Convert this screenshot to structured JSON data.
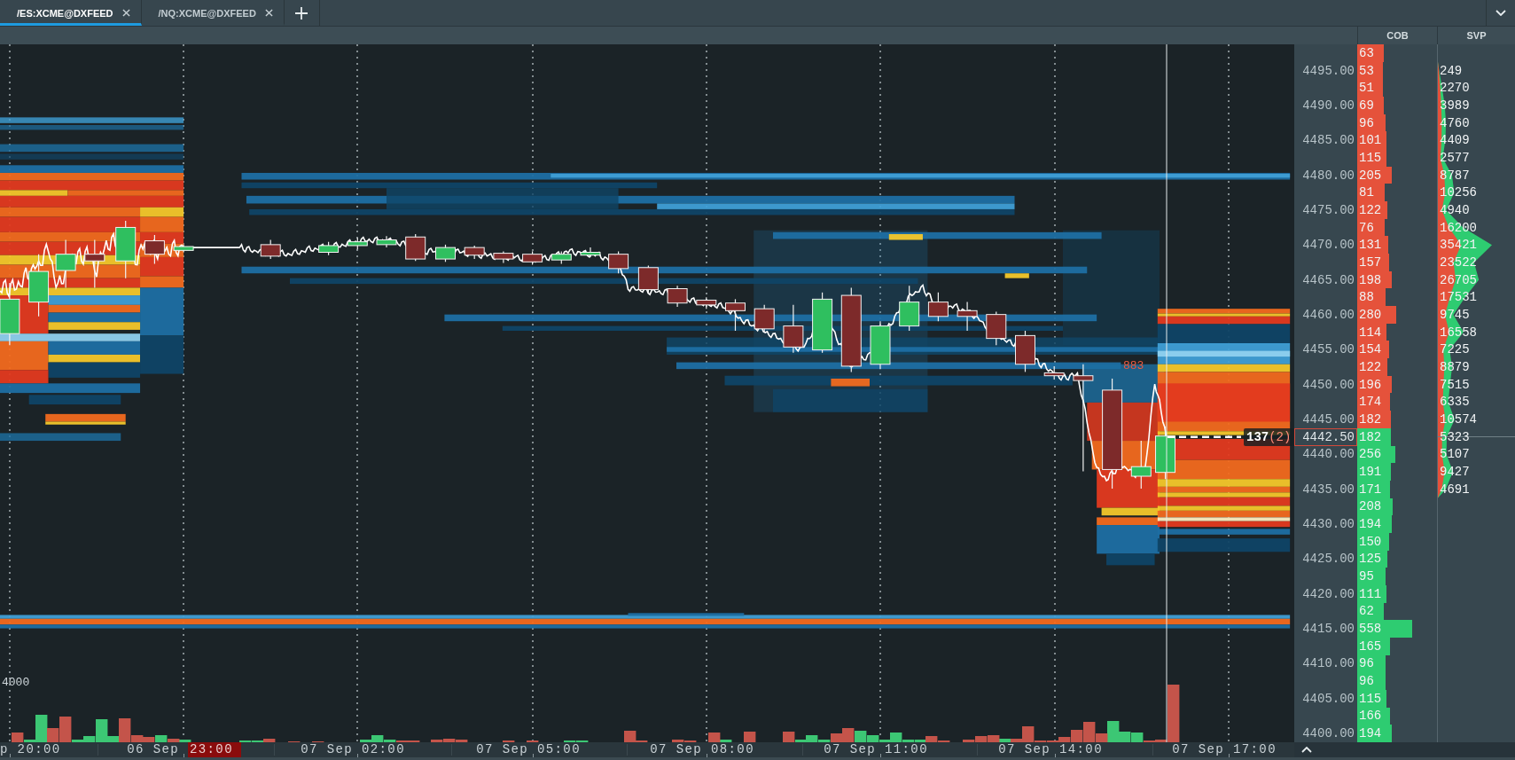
{
  "tabs": [
    {
      "label": "/ES:XCME@DXFEED",
      "selected": true
    },
    {
      "label": "/NQ:XCME@DXFEED",
      "selected": false
    }
  ],
  "depth_columns": [
    {
      "label": "COB"
    },
    {
      "label": "SVP"
    }
  ],
  "chart": {
    "volume_tick": "4000",
    "trade_label": "883",
    "price_tag": "137",
    "price_tag_count": "(2)"
  },
  "ladder": [
    {
      "cob": "63",
      "color": "#e5523b",
      "current": false
    },
    {
      "price": "4495.00",
      "cob": "53",
      "color": "#e5523b",
      "svp": "249",
      "current": false
    },
    {
      "cob": "51",
      "color": "#e5523b",
      "svp": "2270",
      "current": false
    },
    {
      "price": "4490.00",
      "cob": "69",
      "color": "#e5523b",
      "svp": "3989",
      "current": false
    },
    {
      "cob": "96",
      "color": "#e5523b",
      "svp": "4760",
      "current": false
    },
    {
      "price": "4485.00",
      "cob": "101",
      "color": "#e5523b",
      "svp": "4409",
      "current": false
    },
    {
      "cob": "115",
      "color": "#e5523b",
      "svp": "2577",
      "current": false
    },
    {
      "price": "4480.00",
      "cob": "205",
      "color": "#e5523b",
      "svp": "8787",
      "current": false
    },
    {
      "cob": "81",
      "color": "#e5523b",
      "svp": "10256",
      "current": false
    },
    {
      "price": "4475.00",
      "cob": "122",
      "color": "#e5523b",
      "svp": "4940",
      "current": false
    },
    {
      "cob": "76",
      "color": "#e5523b",
      "svp": "16200",
      "current": false
    },
    {
      "price": "4470.00",
      "cob": "131",
      "color": "#e5523b",
      "svp": "35421",
      "current": false
    },
    {
      "cob": "157",
      "color": "#e5523b",
      "svp": "23522",
      "current": false
    },
    {
      "price": "4465.00",
      "cob": "198",
      "color": "#e5523b",
      "svp": "26705",
      "current": false
    },
    {
      "cob": "88",
      "color": "#e5523b",
      "svp": "17531",
      "current": false
    },
    {
      "price": "4460.00",
      "cob": "280",
      "color": "#e5523b",
      "svp": "9745",
      "current": false
    },
    {
      "cob": "114",
      "color": "#e5523b",
      "svp": "16558",
      "current": false
    },
    {
      "price": "4455.00",
      "cob": "154",
      "color": "#e5523b",
      "svp": "7225",
      "current": false
    },
    {
      "cob": "122",
      "color": "#e5523b",
      "svp": "8879",
      "current": false
    },
    {
      "price": "4450.00",
      "cob": "196",
      "color": "#e5523b",
      "svp": "7515",
      "current": false
    },
    {
      "cob": "174",
      "color": "#e5523b",
      "svp": "6335",
      "current": false
    },
    {
      "price": "4445.00",
      "cob": "182",
      "color": "#e5523b",
      "svp": "10574",
      "current": false
    },
    {
      "price": "4442.50",
      "cob": "182",
      "color": "#2ecc71",
      "svp": "5323",
      "current": true
    },
    {
      "price": "4440.00",
      "cob": "256",
      "color": "#2ecc71",
      "svp": "5107",
      "current": false
    },
    {
      "cob": "191",
      "color": "#2ecc71",
      "svp": "9427",
      "current": false
    },
    {
      "price": "4435.00",
      "cob": "171",
      "color": "#2ecc71",
      "svp": "4691",
      "current": false
    },
    {
      "cob": "208",
      "color": "#2ecc71",
      "current": false
    },
    {
      "price": "4430.00",
      "cob": "194",
      "color": "#2ecc71",
      "current": false
    },
    {
      "cob": "150",
      "color": "#2ecc71",
      "current": false
    },
    {
      "price": "4425.00",
      "cob": "125",
      "color": "#2ecc71",
      "current": false
    },
    {
      "cob": "95",
      "color": "#2ecc71",
      "current": false
    },
    {
      "price": "4420.00",
      "cob": "111",
      "color": "#2ecc71",
      "current": false
    },
    {
      "cob": "62",
      "color": "#2ecc71",
      "current": false
    },
    {
      "price": "4415.00",
      "cob": "558",
      "color": "#2ecc71",
      "current": false
    },
    {
      "cob": "165",
      "color": "#2ecc71",
      "current": false
    },
    {
      "price": "4410.00",
      "cob": "96",
      "color": "#2ecc71",
      "current": false
    },
    {
      "cob": "96",
      "color": "#2ecc71",
      "current": false
    },
    {
      "price": "4405.00",
      "cob": "115",
      "color": "#2ecc71",
      "current": false
    },
    {
      "cob": "166",
      "color": "#2ecc71",
      "current": false
    },
    {
      "price": "4400.00",
      "cob": "194",
      "color": "#2ecc71",
      "current": false
    }
  ],
  "time_axis": {
    "labels": [
      {
        "date": "p",
        "time": "20:00",
        "highlighted": false
      },
      {
        "date": "06 Sep",
        "time": "23:00",
        "highlighted": true
      },
      {
        "date": "07 Sep",
        "time": "02:00",
        "highlighted": false
      },
      {
        "date": "07 Sep",
        "time": "05:00",
        "highlighted": false
      },
      {
        "date": "07 Sep",
        "time": "08:00",
        "highlighted": false
      },
      {
        "date": "07 Sep",
        "time": "11:00",
        "highlighted": false
      },
      {
        "date": "07 Sep",
        "time": "14:00",
        "highlighted": false
      },
      {
        "date": "07 Sep",
        "time": "17:00",
        "highlighted": false
      }
    ]
  }
}
